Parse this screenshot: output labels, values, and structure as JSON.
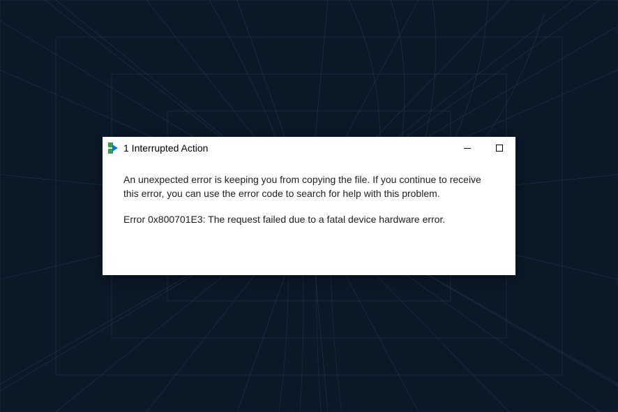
{
  "dialog": {
    "title": "1 Interrupted Action",
    "message": "An unexpected error is keeping you from copying the file. If you continue to receive this error, you can use the error code to search for help with this problem.",
    "error_line": "Error 0x800701E3: The request failed due to a fatal device hardware error."
  }
}
